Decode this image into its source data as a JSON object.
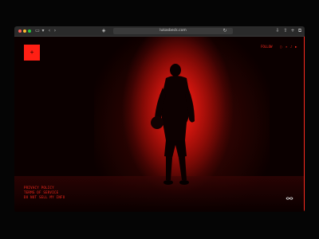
{
  "browser": {
    "url": "lukasbeck.com",
    "accent": "#ff2a1e",
    "traffic_lights": [
      "#ff5f57",
      "#febc2e",
      "#28c840"
    ]
  },
  "site": {
    "logo_symbol": "+",
    "nav": {
      "menu_label": "FOLLOW",
      "icons": [
        "instagram-icon",
        "x-icon",
        "music-icon",
        "play-icon"
      ]
    },
    "footer_links": [
      "PRIVACY POLICY",
      "TERMS OF SERVICE",
      "DO NOT SELL MY INFO"
    ],
    "sound_toggle_icon": "sound-toggle-icon",
    "hero_image": "basketball-player-silhouette-red-light"
  }
}
